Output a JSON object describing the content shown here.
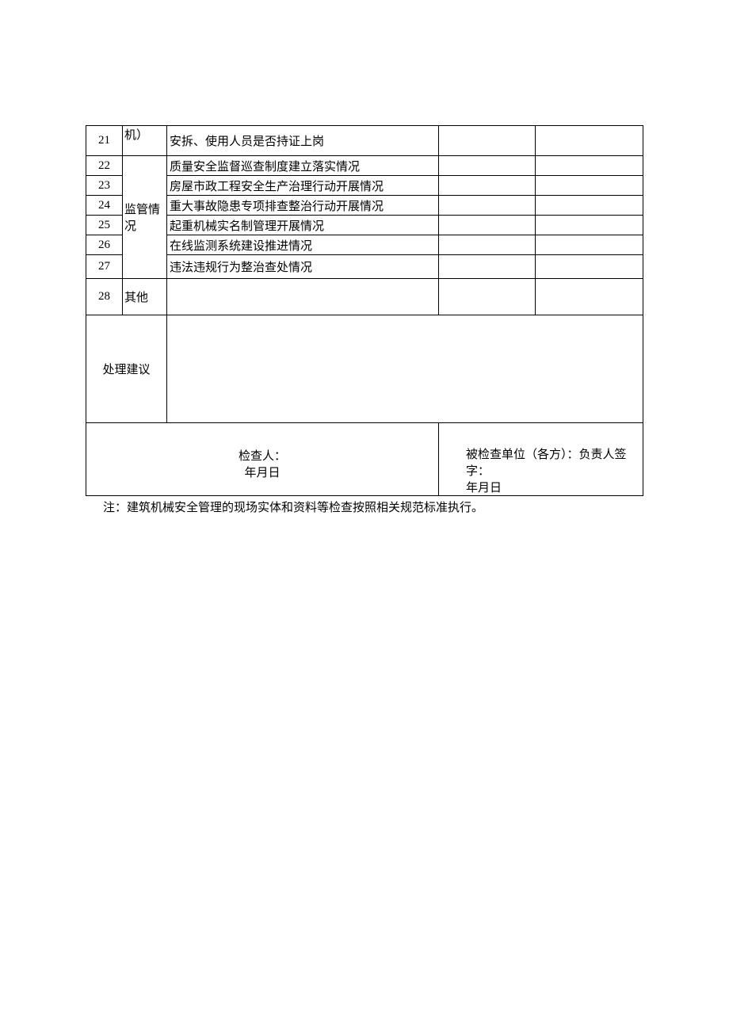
{
  "rows": {
    "r21": {
      "num": "21",
      "cat": "机）",
      "item": "安拆、使用人员是否持证上岗"
    },
    "r22": {
      "num": "22",
      "item": "质量安全监督巡查制度建立落实情况"
    },
    "r23": {
      "num": "23",
      "item": "房屋市政工程安全生产治理行动开展情况"
    },
    "r24": {
      "num": "24",
      "item": "重大事故隐患专项排查整治行动开展情况"
    },
    "r25": {
      "num": "25",
      "item": "起重机械实名制管理开展情况"
    },
    "r26": {
      "num": "26",
      "item": "在线监测系统建设推进情况"
    },
    "r27": {
      "num": "27",
      "item": "违法违规行为整治查处情况"
    },
    "r28": {
      "num": "28",
      "cat": "其他"
    },
    "cat_supervision": "监管情况"
  },
  "suggestion_label": "处理建议",
  "signatures": {
    "left_label": "检查人：",
    "left_date": "年月日",
    "right_label": "被检查单位（各方）：负责人签字：",
    "right_date": "年月日"
  },
  "footnote": "注：建筑机械安全管理的现场实体和资料等检查按照相关规范标准执行。"
}
